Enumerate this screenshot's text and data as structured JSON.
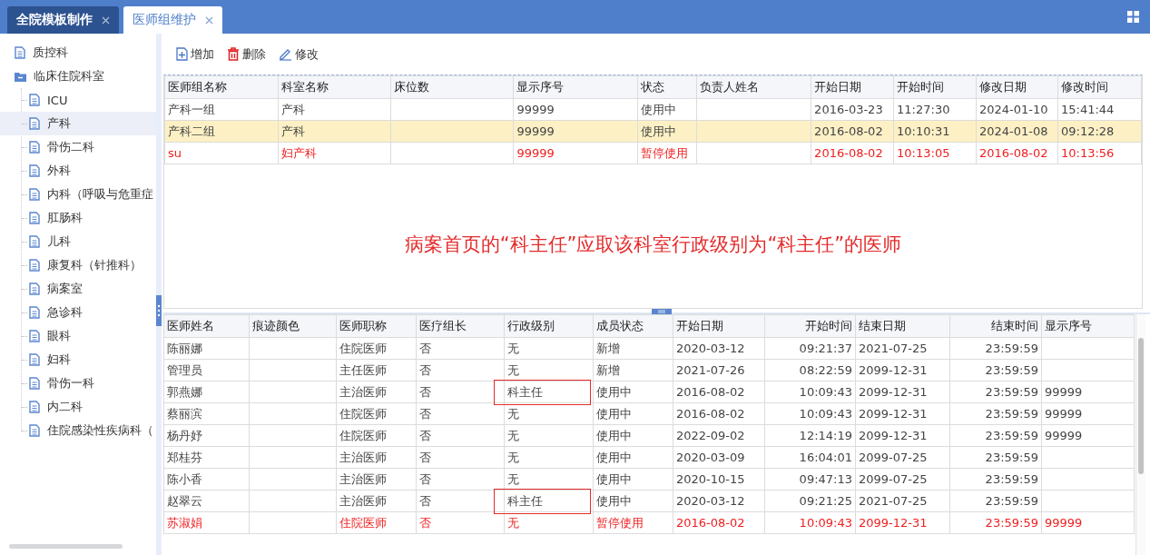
{
  "tabs": [
    {
      "label": "全院模板制作",
      "selected": false
    },
    {
      "label": "医师组维护",
      "selected": true
    }
  ],
  "sidebar": {
    "items": [
      {
        "label": "质控科",
        "kind": "file",
        "selected": false
      },
      {
        "label": "临床住院科室",
        "kind": "folder",
        "expanded": true,
        "selected": false,
        "children": [
          {
            "label": "ICU",
            "kind": "file",
            "selected": false
          },
          {
            "label": "产科",
            "kind": "file",
            "selected": true
          },
          {
            "label": "骨伤二科",
            "kind": "file",
            "selected": false
          },
          {
            "label": "外科",
            "kind": "file",
            "selected": false
          },
          {
            "label": "内科（呼吸与危重症",
            "kind": "file",
            "selected": false
          },
          {
            "label": "肛肠科",
            "kind": "file",
            "selected": false
          },
          {
            "label": "儿科",
            "kind": "file",
            "selected": false
          },
          {
            "label": "康复科（针推科）",
            "kind": "file",
            "selected": false
          },
          {
            "label": "病案室",
            "kind": "file",
            "selected": false
          },
          {
            "label": "急诊科",
            "kind": "file",
            "selected": false
          },
          {
            "label": "眼科",
            "kind": "file",
            "selected": false
          },
          {
            "label": "妇科",
            "kind": "file",
            "selected": false
          },
          {
            "label": "骨伤一科",
            "kind": "file",
            "selected": false
          },
          {
            "label": "内二科",
            "kind": "file",
            "selected": false
          },
          {
            "label": "住院感染性疾病科（",
            "kind": "file",
            "selected": false
          }
        ]
      }
    ]
  },
  "toolbar": {
    "buttons": [
      {
        "label": "增加",
        "kind": "add"
      },
      {
        "label": "删除",
        "kind": "delete"
      },
      {
        "label": "修改",
        "kind": "edit"
      }
    ]
  },
  "groups_table": {
    "columns": [
      {
        "label": "医师组名称"
      },
      {
        "label": "科室名称"
      },
      {
        "label": "床位数"
      },
      {
        "label": "显示序号"
      },
      {
        "label": "状态"
      },
      {
        "label": "负责人姓名"
      },
      {
        "label": "开始日期"
      },
      {
        "label": "开始时间"
      },
      {
        "label": "修改日期"
      },
      {
        "label": "修改时间"
      }
    ],
    "rows": [
      {
        "selected": false,
        "suspended": false,
        "cells": [
          "产科一组",
          "产科",
          null,
          "99999",
          "使用中",
          null,
          "2016-03-23",
          "11:27:30",
          "2024-01-10",
          "15:41:44"
        ]
      },
      {
        "selected": true,
        "suspended": false,
        "cells": [
          "产科二组",
          "产科",
          null,
          "99999",
          "使用中",
          null,
          "2016-08-02",
          "10:10:31",
          "2024-01-08",
          "09:12:28"
        ]
      },
      {
        "selected": false,
        "suspended": true,
        "cells": [
          "su",
          "妇产科",
          null,
          "99999",
          "暂停使用",
          null,
          "2016-08-02",
          "10:13:05",
          "2016-08-02",
          "10:13:56"
        ]
      }
    ]
  },
  "annotation": {
    "text": "病案首页的“科主任”应取该科室行政级别为“科主任”的医师"
  },
  "members_table": {
    "columns": [
      {
        "label": "医师姓名"
      },
      {
        "label": "痕迹颜色"
      },
      {
        "label": "医师职称"
      },
      {
        "label": "医疗组长"
      },
      {
        "label": "行政级别"
      },
      {
        "label": "成员状态"
      },
      {
        "label": "开始日期"
      },
      {
        "label": "开始时间"
      },
      {
        "label": "结束日期"
      },
      {
        "label": "结束时间"
      },
      {
        "label": "显示序号"
      }
    ],
    "rows": [
      {
        "selected": false,
        "suspended": false,
        "boxed": false,
        "cells": [
          "陈丽娜",
          null,
          "住院医师",
          "否",
          "无",
          "新增",
          "2020-03-12",
          "09:21:37",
          "2021-07-25",
          "23:59:59",
          null
        ]
      },
      {
        "selected": false,
        "suspended": false,
        "boxed": false,
        "cells": [
          "管理员",
          null,
          "主任医师",
          "否",
          "无",
          "新增",
          "2021-07-26",
          "08:22:59",
          "2099-12-31",
          "23:59:59",
          null
        ]
      },
      {
        "selected": false,
        "suspended": false,
        "boxed": true,
        "cells": [
          "郭燕娜",
          null,
          "主治医师",
          "否",
          "科主任",
          "使用中",
          "2016-08-02",
          "10:09:43",
          "2099-12-31",
          "23:59:59",
          "99999"
        ]
      },
      {
        "selected": false,
        "suspended": false,
        "boxed": false,
        "cells": [
          "蔡丽滨",
          null,
          "住院医师",
          "否",
          "无",
          "使用中",
          "2016-08-02",
          "10:09:43",
          "2099-12-31",
          "23:59:59",
          "99999"
        ]
      },
      {
        "selected": false,
        "suspended": false,
        "boxed": false,
        "cells": [
          "杨丹妤",
          null,
          "住院医师",
          "否",
          "无",
          "使用中",
          "2022-09-02",
          "12:14:19",
          "2099-12-31",
          "23:59:59",
          "99999"
        ]
      },
      {
        "selected": false,
        "suspended": false,
        "boxed": false,
        "cells": [
          "郑桂芬",
          null,
          "主治医师",
          "否",
          "无",
          "使用中",
          "2020-03-09",
          "16:04:01",
          "2099-07-25",
          "23:59:59",
          null
        ]
      },
      {
        "selected": false,
        "suspended": false,
        "boxed": false,
        "cells": [
          "陈小香",
          null,
          "主治医师",
          "否",
          "无",
          "使用中",
          "2020-10-15",
          "09:47:13",
          "2099-07-25",
          "23:59:59",
          null
        ]
      },
      {
        "selected": false,
        "suspended": false,
        "boxed": true,
        "cells": [
          "赵翠云",
          null,
          "主治医师",
          "否",
          "科主任",
          "使用中",
          "2020-03-12",
          "09:21:25",
          "2021-07-25",
          "23:59:59",
          null
        ]
      },
      {
        "selected": false,
        "suspended": true,
        "boxed": false,
        "cells": [
          "苏淑娟",
          null,
          "住院医师",
          "否",
          "无",
          "暂停使用",
          "2016-08-02",
          "10:09:43",
          "2099-12-31",
          "23:59:59",
          "99999"
        ]
      }
    ]
  }
}
